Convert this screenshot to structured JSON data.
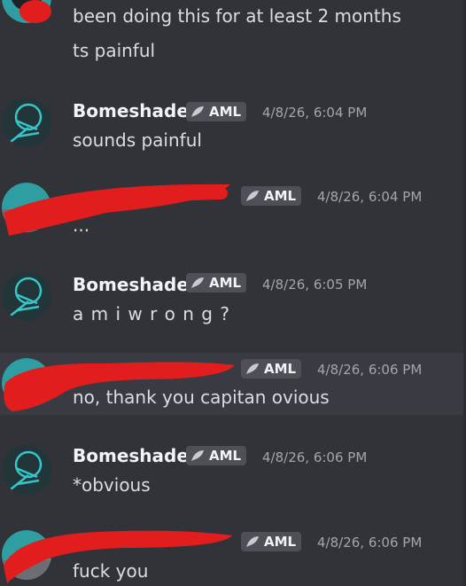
{
  "chat": {
    "colors": {
      "background": "#323339",
      "highlight": "#3a3b42",
      "redaction": "#e11d1d",
      "tag_bg": "#4e5058",
      "avatar_teal": "#36c5c9"
    },
    "messages": [
      {
        "lines": [
          "been doing this for at least 2 months",
          "ts painful"
        ]
      },
      {
        "author": "Bomeshade",
        "tag": "AML",
        "timestamp": "4/8/26, 6:04 PM",
        "text": "sounds painful",
        "avatar_icon": "bomeshade-avatar-icon"
      },
      {
        "author": "",
        "tag": "AML",
        "timestamp": "4/8/26, 6:04 PM",
        "text": "...",
        "avatar_icon": "redacted-avatar-icon"
      },
      {
        "author": "Bomeshade",
        "tag": "AML",
        "timestamp": "4/8/26, 6:05 PM",
        "text": "a m i  w r o n g ?",
        "avatar_icon": "bomeshade-avatar-icon"
      },
      {
        "author": "",
        "tag": "AML",
        "timestamp": "4/8/26, 6:06 PM",
        "text": "no, thank you capitan ovious",
        "avatar_icon": "redacted-avatar-icon"
      },
      {
        "author": "Bomeshade",
        "tag": "AML",
        "timestamp": "4/8/26, 6:06 PM",
        "text": "*obvious",
        "avatar_icon": "bomeshade-avatar-icon"
      },
      {
        "author": "",
        "tag": "AML",
        "timestamp": "4/8/26, 6:06 PM",
        "text": "fuck you",
        "avatar_icon": "redacted-avatar-icon"
      }
    ]
  }
}
